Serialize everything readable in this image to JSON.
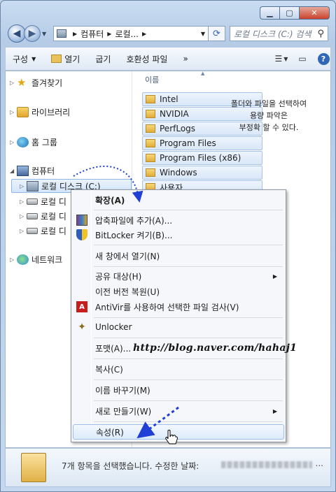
{
  "address": {
    "segments": [
      "컴퓨터",
      "로컬..."
    ]
  },
  "search": {
    "placeholder": "로컬 디스크 (C:) 검색"
  },
  "toolbar": {
    "organize": "구성",
    "open": "열기",
    "burn": "굽기",
    "compat": "호환성 파일",
    "more": "»"
  },
  "nav": {
    "favorites": "즐겨찾기",
    "libraries": "라이브러리",
    "homegroup": "홈 그룹",
    "computer": "컴퓨터",
    "drive_c": "로컬 디스크 (C:)",
    "drive2": "로컬 디",
    "drive3": "로컬 디",
    "drive4": "로컬 디",
    "network": "네트워크"
  },
  "files": {
    "column": "이름",
    "items": [
      "Intel",
      "NVIDIA",
      "PerfLogs",
      "Program Files",
      "Program Files (x86)",
      "Windows",
      "사용자"
    ]
  },
  "note": {
    "line1": "폴더와 파일을 선택하여",
    "line2": "용량 파악은",
    "line3": "부정확 할 수 있다."
  },
  "menu": {
    "expand": "확장(A)",
    "add_archive": "압축파일에 추가(A)...",
    "bitlocker": "BitLocker 켜기(B)...",
    "new_window": "새 창에서 열기(N)",
    "share": "공유 대상(H)",
    "restore": "이전 버전 복원(U)",
    "antivir": "AntiVir를 사용하여 선택한 파일 검사(V)",
    "unlocker": "Unlocker",
    "format": "포맷(A)...",
    "copy": "복사(C)",
    "rename": "이름 바꾸기(M)",
    "new": "새로 만들기(W)",
    "properties": "속성(R)"
  },
  "watermark": "http://blog.naver.com/hahaj1",
  "status": {
    "text": "7개 항목을 선택했습니다. 수정한 날짜:",
    "ellipsis": "..."
  },
  "colors": {
    "arrow": "#1f3fd6",
    "selection": "#d9e7f8",
    "close": "#c7432c"
  }
}
